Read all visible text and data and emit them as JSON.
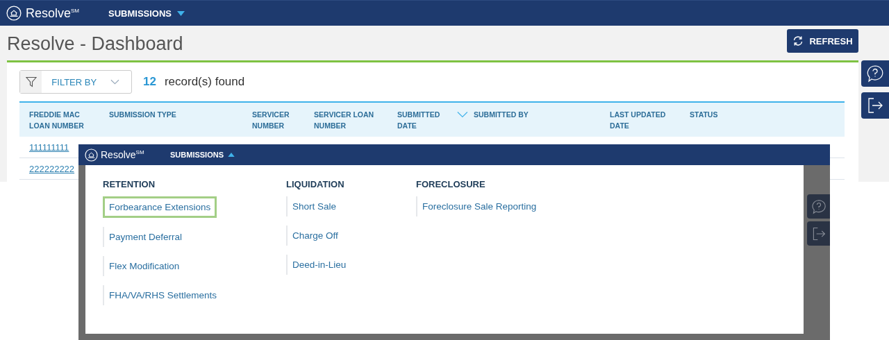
{
  "dashboard": {
    "nav": {
      "brand": "Resolve",
      "brand_mark": "SM",
      "menu": "SUBMISSIONS",
      "expanded": false
    },
    "title": "Resolve - Dashboard",
    "refresh_button": "REFRESH",
    "filter": {
      "label": "FILTER BY"
    },
    "record_count": "12",
    "record_label": "record(s) found",
    "table": {
      "columns": [
        {
          "label": "FREDDIE MAC LOAN NUMBER",
          "sorted": false
        },
        {
          "label": "SUBMISSION TYPE",
          "sorted": false
        },
        {
          "label": "SERVICER NUMBER",
          "sorted": false
        },
        {
          "label": "SERVICER LOAN NUMBER",
          "sorted": false
        },
        {
          "label": "SUBMITTED DATE",
          "sorted": true
        },
        {
          "label": "SUBMITTED BY",
          "sorted": false
        },
        {
          "label": "LAST UPDATED DATE",
          "sorted": false
        },
        {
          "label": "STATUS",
          "sorted": false
        }
      ],
      "rows": [
        {
          "loan_number": "111111111"
        },
        {
          "loan_number": "222222222"
        }
      ]
    }
  },
  "submissions_menu": {
    "nav": {
      "brand": "Resolve",
      "brand_mark": "SM",
      "menu": "SUBMISSIONS",
      "expanded": true
    },
    "groups": [
      {
        "heading": "RETENTION",
        "items": [
          {
            "label": "Forbearance Extensions",
            "selected": true
          },
          {
            "label": "Payment Deferral",
            "selected": false
          },
          {
            "label": "Flex Modification",
            "selected": false
          },
          {
            "label": "FHA/VA/RHS Settlements",
            "selected": false
          }
        ]
      },
      {
        "heading": "LIQUIDATION",
        "items": [
          {
            "label": "Short Sale",
            "selected": false
          },
          {
            "label": "Charge Off",
            "selected": false
          },
          {
            "label": "Deed-in-Lieu",
            "selected": false
          }
        ]
      },
      {
        "heading": "FORECLOSURE",
        "items": [
          {
            "label": "Foreclosure Sale Reporting",
            "selected": false
          }
        ]
      }
    ]
  }
}
